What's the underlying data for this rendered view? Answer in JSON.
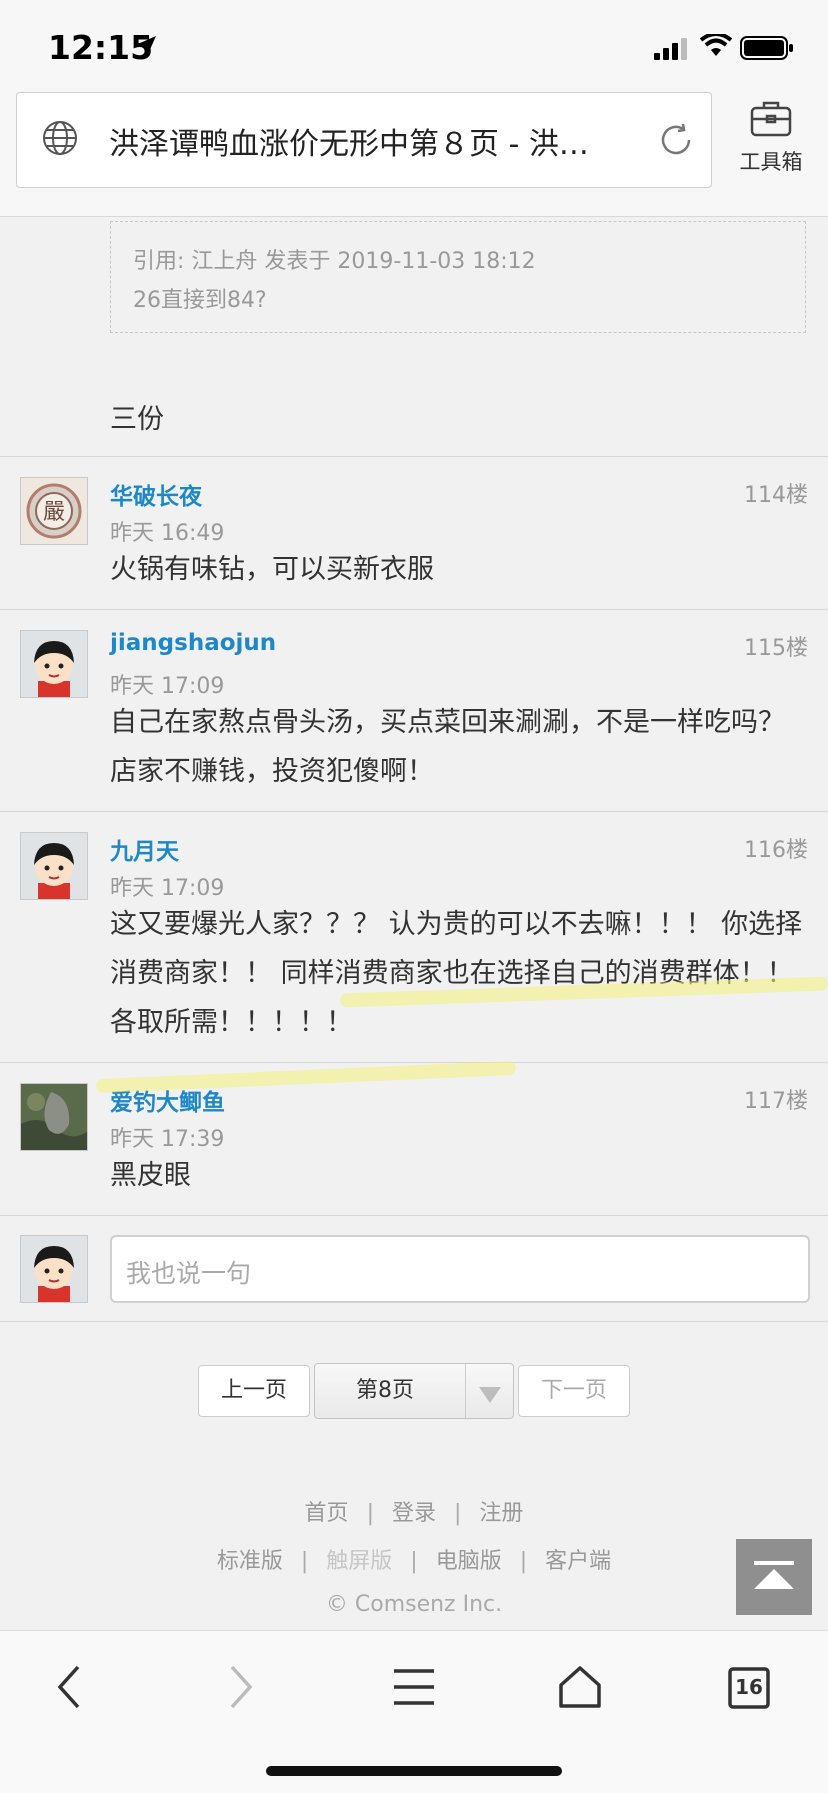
{
  "status": {
    "time": "12:15"
  },
  "browser": {
    "page_title": "洪泽谭鸭血涨价无形中第８页 - 洪…",
    "toolbox_label": "工具箱",
    "tab_count": "16"
  },
  "quote": {
    "line1": "引用: 江上舟 发表于 2019-11-03 18:12",
    "line2": "26直接到84?"
  },
  "reply_text": "三份",
  "posts": [
    {
      "user": "华破长夜",
      "floor": "114楼",
      "time": "昨天 16:49",
      "text": "火锅有味钻，可以买新衣服"
    },
    {
      "user": "jiangshaojun",
      "floor": "115楼",
      "time": "昨天 17:09",
      "text": "自己在家熬点骨头汤，买点菜回来涮涮，不是一样吃吗？店家不赚钱，投资犯傻啊！"
    },
    {
      "user": "九月天",
      "floor": "116楼",
      "time": "昨天 17:09",
      "text": "这又要爆光人家？？？ 认为贵的可以不去嘛！！！ 你选择消费商家！！ 同样消费商家也在选择自己的消费群体！！ 各取所需！！！！！"
    },
    {
      "user": "爱钓大鲫鱼",
      "floor": "117楼",
      "time": "昨天 17:39",
      "text": "黑皮眼"
    }
  ],
  "comment": {
    "placeholder": "我也说一句"
  },
  "pagination": {
    "prev": "上一页",
    "current": "第8页",
    "next": "下一页"
  },
  "footer": {
    "links1": [
      "首页",
      "登录",
      "注册"
    ],
    "links2": [
      "标准版",
      "触屏版",
      "电脑版",
      "客户端"
    ],
    "copyright": "© Comsenz Inc."
  },
  "colors": {
    "username": "#1e88c6",
    "meta": "#999999",
    "background": "#f1f1f1"
  }
}
